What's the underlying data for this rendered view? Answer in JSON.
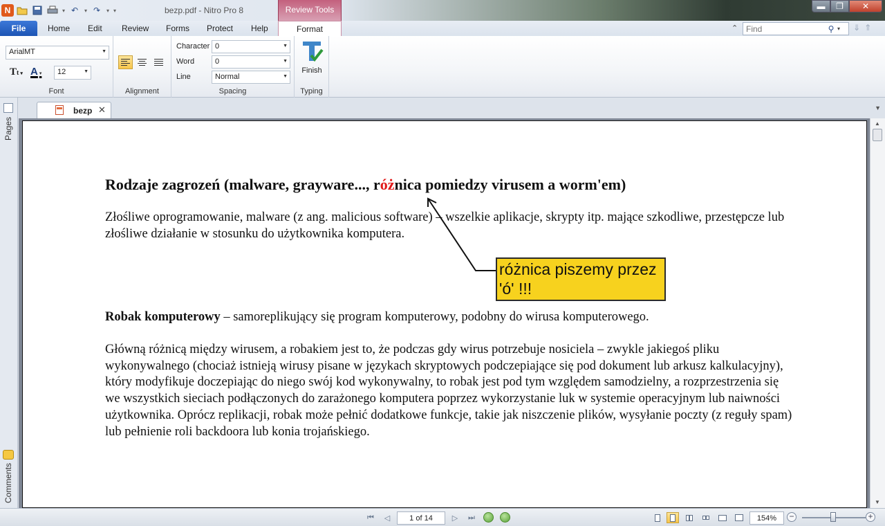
{
  "window": {
    "title": "bezp.pdf - Nitro Pro 8",
    "contextual_group": "Review Tools",
    "controls": {
      "minimize": "▬",
      "maximize": "❐",
      "close": "✕"
    }
  },
  "quick_access": {
    "icons": [
      "app-logo-icon",
      "open-folder-icon",
      "save-icon",
      "print-icon",
      "undo-icon",
      "redo-icon",
      "customize-icon"
    ]
  },
  "tabs": {
    "file": "File",
    "items": [
      "Home",
      "Edit",
      "Review",
      "Forms",
      "Protect",
      "Help"
    ],
    "format": "Format"
  },
  "find": {
    "placeholder": "Find",
    "value": ""
  },
  "ribbon": {
    "font": {
      "group_label": "Font",
      "font_name": "ArialMT",
      "font_size": "12"
    },
    "alignment": {
      "group_label": "Alignment",
      "active": "left"
    },
    "spacing": {
      "group_label": "Spacing",
      "character_label": "Character",
      "character_value": "0",
      "word_label": "Word",
      "word_value": "0",
      "line_label": "Line",
      "line_value": "Normal"
    },
    "typing": {
      "group_label": "Typing",
      "finish_label": "Finish"
    }
  },
  "left_panel": {
    "pages_label": "Pages",
    "comments_label": "Comments"
  },
  "document_tab": {
    "name": "bezp"
  },
  "document": {
    "heading_before": "Rodzaje zagrozeń (malware, grayware..., r",
    "heading_highlight": "óż",
    "heading_after": "nica pomiedzy virusem a worm'em)",
    "para1": "Złośliwe oprogramowanie, malware (z ang. malicious software) – wszelkie aplikacje, skrypty itp. mające szkodliwe, przestępcze lub złośliwe działanie w stosunku do użytkownika komputera.",
    "para2_bold": "Robak komputerowy",
    "para2_rest": " – samoreplikujący się program komputerowy, podobny do wirusa komputerowego.",
    "para3": "Główną różnicą między wirusem, a robakiem jest to, że podczas gdy wirus potrzebuje nosiciela – zwykle jakiegoś pliku wykonywalnego (chociaż istnieją wirusy pisane w językach skryptowych podczepiające się pod dokument lub arkusz kalkulacyjny), który modyfikuje doczepiając do niego swój kod wykonywalny, to robak jest pod tym względem samodzielny, a rozprzestrzenia się we wszystkich sieciach podłączonych do zarażonego komputera poprzez wykorzystanie luk w systemie operacyjnym lub naiwności użytkownika. Oprócz replikacji, robak może pełnić dodatkowe funkcje, takie jak niszczenie plików, wysyłanie poczty (z reguły spam) lub pełnienie roli backdoora lub konia trojańskiego.",
    "callout": "różnica piszemy przez 'ó' !!!"
  },
  "statusbar": {
    "page_display": "1 of 14",
    "zoom": "154%"
  },
  "colors": {
    "accent": "#1d55b4",
    "contextual": "#c3607d",
    "callout_fill": "#f7d21e",
    "highlight_text": "#e01a1a"
  }
}
